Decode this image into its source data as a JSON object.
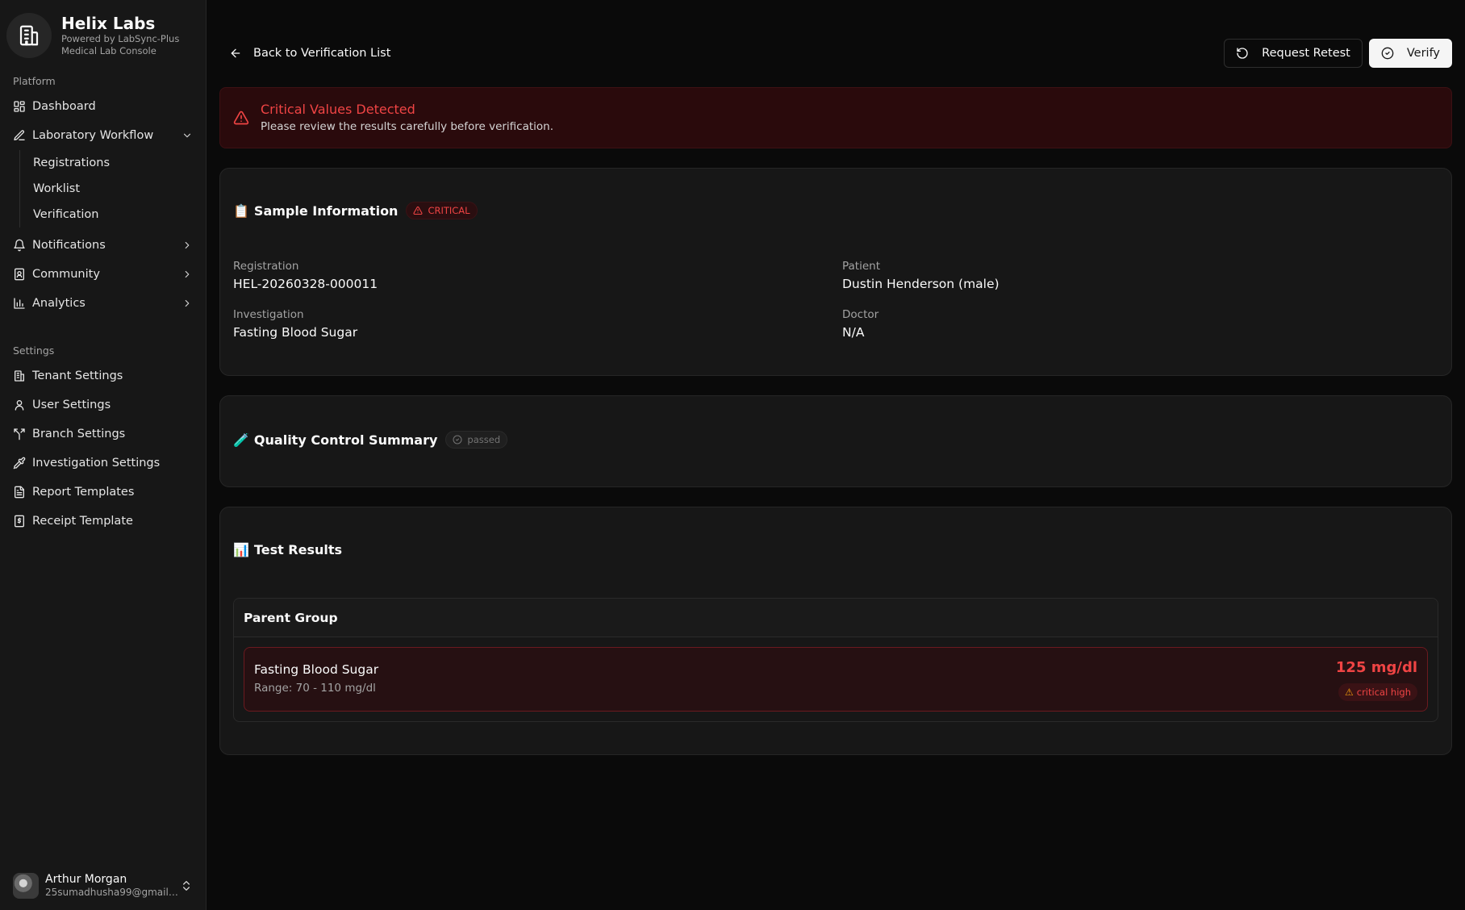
{
  "brand": {
    "name": "Helix Labs",
    "subtitle_1": "Powered by LabSync-Plus",
    "subtitle_2": "Medical Lab Console",
    "icon": "building-icon"
  },
  "sidebar": {
    "platform_label": "Platform",
    "settings_label": "Settings",
    "platform_items": [
      {
        "label": "Dashboard",
        "icon": "dashboard-icon"
      },
      {
        "label": "Laboratory Workflow",
        "icon": "pen-icon",
        "expanded": true,
        "children": [
          "Registrations",
          "Worklist",
          "Verification"
        ]
      },
      {
        "label": "Notifications",
        "icon": "bell-icon"
      },
      {
        "label": "Community",
        "icon": "book-user-icon"
      },
      {
        "label": "Analytics",
        "icon": "bar-chart-icon"
      }
    ],
    "settings_items": [
      {
        "label": "Tenant Settings",
        "icon": "building-icon"
      },
      {
        "label": "User Settings",
        "icon": "user-icon"
      },
      {
        "label": "Branch Settings",
        "icon": "branch-icon"
      },
      {
        "label": "Investigation Settings",
        "icon": "pipette-icon"
      },
      {
        "label": "Report Templates",
        "icon": "file-text-icon"
      },
      {
        "label": "Receipt Template",
        "icon": "receipt-icon"
      }
    ]
  },
  "user": {
    "name": "Arthur Morgan",
    "email": "25sumadhusha99@gmail.c..."
  },
  "header": {
    "back_label": "Back to Verification List",
    "retest_label": "Request Retest",
    "verify_label": "Verify"
  },
  "alert": {
    "title": "Critical Values Detected",
    "description": "Please review the results carefully before verification."
  },
  "sample": {
    "emoji": "📋",
    "title": "Sample Information",
    "badge": "CRITICAL",
    "registration_label": "Registration",
    "registration_value": "HEL-20260328-000011",
    "patient_label": "Patient",
    "patient_value": "Dustin Henderson (male)",
    "investigation_label": "Investigation",
    "investigation_value": "Fasting Blood Sugar",
    "doctor_label": "Doctor",
    "doctor_value": "N/A"
  },
  "qc": {
    "emoji": "🧪",
    "title": "Quality Control Summary",
    "badge": "passed"
  },
  "results": {
    "emoji": "📊",
    "title": "Test Results",
    "group_name": "Parent Group",
    "items": [
      {
        "name": "Fasting Blood Sugar",
        "range": "Range: 70 - 110 mg/dl",
        "value": "125 mg/dl",
        "flag": "critical high"
      }
    ]
  },
  "colors": {
    "critical": "#ef4444",
    "background": "#0a0a0a",
    "card": "#171717"
  }
}
